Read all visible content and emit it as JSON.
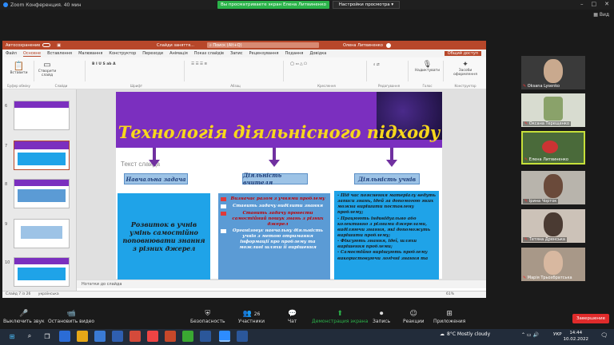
{
  "zoom": {
    "window_title": "Zoom Конференция. 40 мин",
    "share_banner": "Вы просматриваете экран Елена Литвиненко",
    "view_options": "Настройки просмотра",
    "view_button": "Вид"
  },
  "ppt": {
    "autosave": "Автосохранение",
    "doc_title": "Слайди заняття...",
    "search": "Поиск (Alt+Q)",
    "user": "Олена Литвиненко",
    "share": "Общий доступ",
    "menu": [
      "Файл",
      "Основне",
      "Вставлення",
      "Малювання",
      "Конструктор",
      "Переходи",
      "Анімація",
      "Показ слайдів",
      "Запис",
      "Рецензування",
      "Подання",
      "Довідка"
    ],
    "ribbon_groups": [
      "Буфер обміну",
      "Слайди",
      "Шрифт",
      "Абзац",
      "Креслення",
      "Редагування",
      "Голос",
      "Конструктор"
    ],
    "ribbon_labels": {
      "paste": "Вставити",
      "new_slide": "Створити слайд",
      "dictate": "Надиктувати",
      "designer": "Засоби оформлення"
    },
    "thumb_numbers": [
      "6",
      "7",
      "8",
      "9",
      "10"
    ],
    "notes": "Нотатки до слайда",
    "status_left": "Слайд 7 із 26",
    "status_lang": "українська",
    "status_right": "61%"
  },
  "slide": {
    "title": "Технологія діяльнісного підходу",
    "placeholder": "Текст слайда",
    "headers": [
      "Навчальна задача",
      "Діяльність вчителя",
      "Діяльність учнів"
    ],
    "col1": "Розвиток в учнів умінь самостійно поповнювати знання з різних джерел",
    "col2": [
      {
        "text": "Визначає разом з учнями проблему",
        "style": "red"
      },
      {
        "text": "Ставить задачу виділити знання",
        "style": "white"
      },
      {
        "text": "Ставить задачу провести самостійний пошук знань з різних джерел",
        "style": "red"
      },
      {
        "text": "Організовує навчальну діяльність учнів з метою отримання інформації про проблему та можливі шляхи її вирішення",
        "style": "white"
      }
    ],
    "col3": [
      "- Під час пояснення матеріалу ведуть записи знань, ідей за допомогою яких можна вирішити поставлену проблему;",
      "- Працюють індивідуально або колективно з різними джерелами, виділяючи знання, які допоможуть вирішити проблему;",
      "- Фіксують знання, ідеї, шляхи вирішення проблеми;",
      "- Самостійно вирішують проблему використовуючи логічні знання та"
    ]
  },
  "participants": [
    {
      "name": "Oksana Lysenko"
    },
    {
      "name": "Оксана Терещенко"
    },
    {
      "name": "Елена Литвиненко"
    },
    {
      "name": "Ірина Чорток"
    },
    {
      "name": "Тетяна Дренська"
    },
    {
      "name": "Марія Трьохбратська"
    }
  ],
  "toolbar": {
    "mute": "Выключить звук",
    "video": "Остановить видео",
    "security": "Безопасность",
    "participants": "Участники",
    "participants_count": "26",
    "chat": "Чат",
    "share": "Демонстрация экрана",
    "record": "Запись",
    "reactions": "Реакции",
    "apps": "Приложения",
    "end": "Завершение"
  },
  "taskbar": {
    "weather": "8°C Mostly cloudy",
    "lang": "УКР",
    "time": "14:44",
    "date": "10.02.2022"
  },
  "colors": {
    "ppt_accent": "#b7472a",
    "slide_purple": "#7b2fbf",
    "title_yellow": "#f7d71c",
    "share_green": "#2bb34a",
    "end_red": "#e02b2b"
  }
}
